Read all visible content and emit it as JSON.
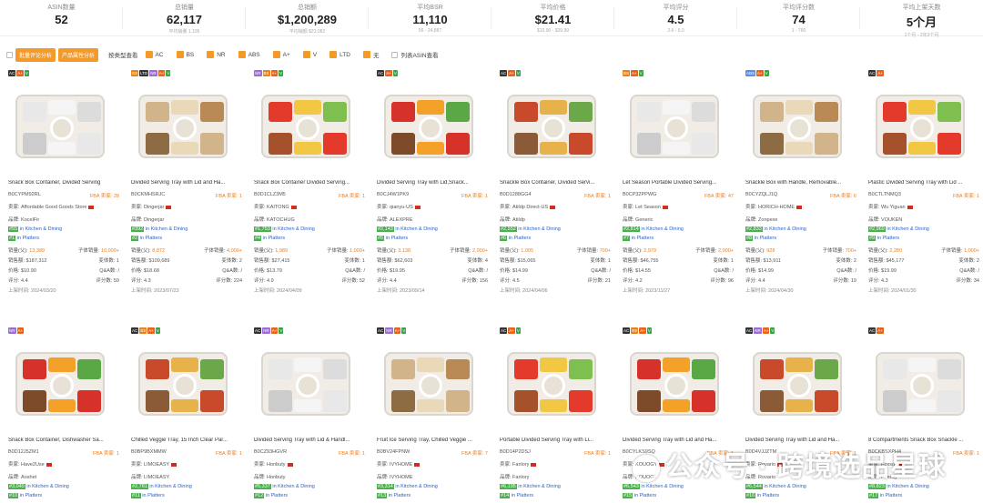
{
  "stats": [
    {
      "label": "ASIN数量",
      "value": "52",
      "sub": ""
    },
    {
      "label": "总销量",
      "value": "62,117",
      "sub": "平均销量 1,195"
    },
    {
      "label": "总销额",
      "value": "$1,200,289",
      "sub": "平均销额 $23,082"
    },
    {
      "label": "平均BSR",
      "value": "11,110",
      "sub": "56 - 24,887"
    },
    {
      "label": "平均价格",
      "value": "$21.41",
      "sub": "$10.90 - $39.99"
    },
    {
      "label": "平均评分",
      "value": "4.5",
      "sub": "2.6 - 5.0"
    },
    {
      "label": "平均评分数",
      "value": "74",
      "sub": "1 - 760"
    },
    {
      "label": "平均上架天数",
      "value": "5个月",
      "sub": "1个月 - 2年3个月"
    }
  ],
  "toolbar": {
    "btn1": "批量评论分析",
    "btn2": "产品属性分析",
    "view": "按类型查看",
    "filters": [
      "AC",
      "BS",
      "NR",
      "ABS",
      "A+",
      "V",
      "LTD",
      "无"
    ],
    "list_toggle": "列表ASIN查看"
  },
  "row1": [
    {
      "tags": [
        "AC",
        "A+",
        "V"
      ],
      "title": "Snack Box Container, Divided Serving",
      "asin": "B0CYPM92RL",
      "fba": "FBA 卖家: 28",
      "seller": "卖家: Affordable Good Goods Store",
      "brand": "品牌: KocelFir",
      "rank1": "#55 in Kitchen & Dining",
      "rank2": "#1 in Platters",
      "l1a": "销量(父):",
      "l1b": "13,389",
      "l1c": "子体销量: 10,000+",
      "l2a": "销售额: $187,312",
      "l2b": "变体数: 1",
      "l3a": "价格: $10.90",
      "l3b": "Q&A数: /",
      "l4a": "评分: 4.4",
      "l4b": "评分数: 59",
      "date": "上架时间: 2024/03/20"
    },
    {
      "tags": [
        "BS",
        "LTD",
        "NR",
        "A+",
        "V"
      ],
      "title": "Divided Serving Tray with Lid and Ha...",
      "asin": "B0CKMHSRJC",
      "fba": "FBA 卖家: 1",
      "seller": "卖家: Dingerjar",
      "brand": "品牌: Dingerjar",
      "rank1": "#392 in Kitchen & Dining",
      "rank2": "#2 in Platters",
      "l1a": "销量(父):",
      "l1b": "8,872",
      "l1c": "子体销量: 4,000+",
      "l2a": "销售额: $109,689",
      "l2b": "变体数: 2",
      "l3a": "价格: $18.68",
      "l3b": "Q&A数: /",
      "l4a": "评分: 4.3",
      "l4b": "评分数: 224",
      "date": "上架时间: 2023/07/23"
    },
    {
      "tags": [
        "NR",
        "BS",
        "A+",
        "V"
      ],
      "title": "Snack Box Container Divided Serving...",
      "asin": "B0D1CLZ3M5",
      "fba": "FBA 卖家: 1",
      "seller": "卖家: KAITONG",
      "brand": "品牌: KATOCHUG",
      "rank1": "#1,753 in Kitchen & Dining",
      "rank2": "#4 in Platters",
      "l1a": "销量(父):",
      "l1b": "1,989",
      "l1c": "子体销量: 1,000+",
      "l2a": "销售额: $27,415",
      "l2b": "变体数: 1",
      "l3a": "价格: $13.79",
      "l3b": "Q&A数: /",
      "l4a": "评分: 4.9",
      "l4b": "评分数: 52",
      "date": "上架时间: 2024/04/09"
    },
    {
      "tags": [
        "AC",
        "A+",
        "V"
      ],
      "title": "Divided Serving Tray with Lid,Snack...",
      "asin": "B0CJ4W1PK9",
      "fba": "FBA 卖家: 1",
      "seller": "卖家: qianyu-US",
      "brand": "品牌: ALEXPRE",
      "rank1": "#2,143 in Kitchen & Dining",
      "rank2": "#5 in Platters",
      "l1a": "销量(父):",
      "l1b": "3,138",
      "l1c": "子体销量: 2,000+",
      "l2a": "销售额: $62,603",
      "l2b": "变体数: 4",
      "l3a": "价格: $19.95",
      "l3b": "Q&A数: /",
      "l4a": "评分: 4.4",
      "l4b": "评分数: 156",
      "date": "上架时间: 2023/09/14"
    },
    {
      "tags": [
        "AC",
        "A+",
        "V"
      ],
      "title": "Snackle Box Container, Divided Servi...",
      "asin": "B0D1288GG4",
      "fba": "FBA 卖家: 1",
      "seller": "卖家: Atildp Direct-US",
      "brand": "品牌: Atildp",
      "rank1": "#2,552 in Kitchen & Dining",
      "rank2": "#6 in Platters",
      "l1a": "销量(父):",
      "l1b": "1,005",
      "l1c": "子体销量: 700+",
      "l2a": "销售额: $15,065",
      "l2b": "变体数: 1",
      "l3a": "价格: $14.99",
      "l3b": "Q&A数: /",
      "l4a": "评分: 4.5",
      "l4b": "评分数: 21",
      "date": "上架时间: 2024/04/06"
    },
    {
      "tags": [
        "BS",
        "A+",
        "V"
      ],
      "title": "Let Season Portable Divided Serving...",
      "asin": "B0CP32PPWG",
      "fba": "FBA 卖家: 47",
      "seller": "卖家: Let Season",
      "brand": "品牌: Generic",
      "rank1": "#2,814 in Kitchen & Dining",
      "rank2": "#7 in Platters",
      "l1a": "销量(父):",
      "l1b": "2,979",
      "l1c": "子体销量: 2,000+",
      "l2a": "销售额: $46,755",
      "l2b": "变体数: 1",
      "l3a": "价格: $14.55",
      "l3b": "Q&A数: /",
      "l4a": "评分: 4.2",
      "l4b": "评分数: 96",
      "date": "上架时间: 2023/11/27"
    },
    {
      "tags": [
        "ABS",
        "A+",
        "V"
      ],
      "title": "Snackle Box with Handle, Removable...",
      "asin": "B0CYZQLJ1Q",
      "fba": "FBA 卖家: 6",
      "seller": "卖家: HORICH-HOME",
      "brand": "品牌: Zonpexe",
      "rank1": "#2,833 in Kitchen & Dining",
      "rank2": "#8 in Platters",
      "l1a": "销量(父):",
      "l1b": "928",
      "l1c": "子体销量: 700+",
      "l2a": "销售额: $13,911",
      "l2b": "变体数: 2",
      "l3a": "价格: $14.99",
      "l3b": "Q&A数: /",
      "l4a": "评分: 4.4",
      "l4b": "评分数: 19",
      "date": "上架时间: 2024/04/30"
    },
    {
      "tags": [
        "AC",
        "A+"
      ],
      "title": "Plastic Divided Serving Tray with Lid ...",
      "asin": "B0CTLTNMQ3",
      "fba": "FBA 卖家: 1",
      "seller": "卖家: Wu Yiguan",
      "brand": "品牌: VOUKEN",
      "rank1": "#2,969 in Kitchen & Dining",
      "rank2": "#9 in Platters",
      "l1a": "销量(父):",
      "l1b": "2,280",
      "l1c": "子体销量: 1,000+",
      "l2a": "销售额: $45,177",
      "l2b": "变体数: 2",
      "l3a": "价格: $19.99",
      "l3b": "Q&A数: /",
      "l4a": "评分: 4.3",
      "l4b": "评分数: 34",
      "date": "上架时间: 2024/01/30"
    }
  ],
  "row2": [
    {
      "tags": [
        "NR",
        "A+"
      ],
      "title": "Snack Box Container, Dishwasher Sa...",
      "asin": "B0D12J5ZM1",
      "fba": "FBA 卖家: 1",
      "seller": "卖家: Have2Use",
      "brand": "品牌: Aoshet",
      "rank1": "#3,049 in Kitchen & Dining",
      "rank2": "#10 in Platters"
    },
    {
      "tags": [
        "AC",
        "BS",
        "A+",
        "V"
      ],
      "title": "Chilled Veggie Tray, 15 Inch Clear Par...",
      "asin": "B0BP9BXMMW",
      "fba": "FBA 卖家: 1",
      "seller": "卖家: LIMOEASY",
      "brand": "品牌: LIMOEASY",
      "rank1": "#2,781 in Kitchen & Dining",
      "rank2": "#11 in Platters"
    },
    {
      "tags": [
        "AC",
        "NR",
        "A+",
        "V"
      ],
      "title": "Divided Serving Tray with Lid & Handl...",
      "asin": "B0CZ93HGVR",
      "fba": "FBA 卖家: 1",
      "seller": "卖家: Honbuty",
      "brand": "品牌: Honbuty",
      "rank1": "#5,337 in Kitchen & Dining",
      "rank2": "#12 in Platters"
    },
    {
      "tags": [
        "AC",
        "NR",
        "A+",
        "V"
      ],
      "title": "Fruit Ice Serving Tray, Chilled Veggie ...",
      "asin": "B0BV24FPNW",
      "fba": "FBA 卖家: 7",
      "seller": "卖家: IVYHOME",
      "brand": "品牌: IVYHOME",
      "rank1": "#3,314 in Kitchen & Dining",
      "rank2": "#13 in Platters"
    },
    {
      "tags": [
        "AC",
        "A+",
        "V"
      ],
      "title": "Portable Divided Serving Tray with Li...",
      "asin": "B0D14P2DSJ",
      "fba": "FBA 卖家: 1",
      "seller": "卖家: Fanlory",
      "brand": "品牌: Fanlory",
      "rank1": "#6,195 in Kitchen & Dining",
      "rank2": "#14 in Platters"
    },
    {
      "tags": [
        "AC",
        "BS",
        "A+",
        "V"
      ],
      "title": "Divided Serving Tray with Lid and Ha...",
      "asin": "B0CYLKS9SQ",
      "fba": "FBA 卖家: 1",
      "seller": "卖家: KOUOGY",
      "brand": "品牌: KOUOGY",
      "rank1": "#6,543 in Kitchen & Dining",
      "rank2": "#15 in Platters"
    },
    {
      "tags": [
        "AC",
        "NR",
        "A+",
        "V"
      ],
      "title": "Divided Serving Tray with Lid and Ha...",
      "asin": "B0D4VJJZTM",
      "fba": "FBA 卖家: 1",
      "seller": "卖家: Rovario",
      "brand": "品牌: Rovario",
      "rank1": "#6,544 in Kitchen & Dining",
      "rank2": "#16 in Platters"
    },
    {
      "tags": [
        "AC",
        "A+"
      ],
      "title": "8 Compartments Snack Box Snackle ...",
      "asin": "B0CKBSXPH4",
      "fba": "FBA 卖家: 1",
      "seller": "卖家: Foxsdy",
      "brand": "品牌: Foxsdy",
      "rank1": "#8,823 in Kitchen & Dining",
      "rank2": "#17 in Platters"
    }
  ],
  "watermark": "公众号 · 跨境选品星球"
}
